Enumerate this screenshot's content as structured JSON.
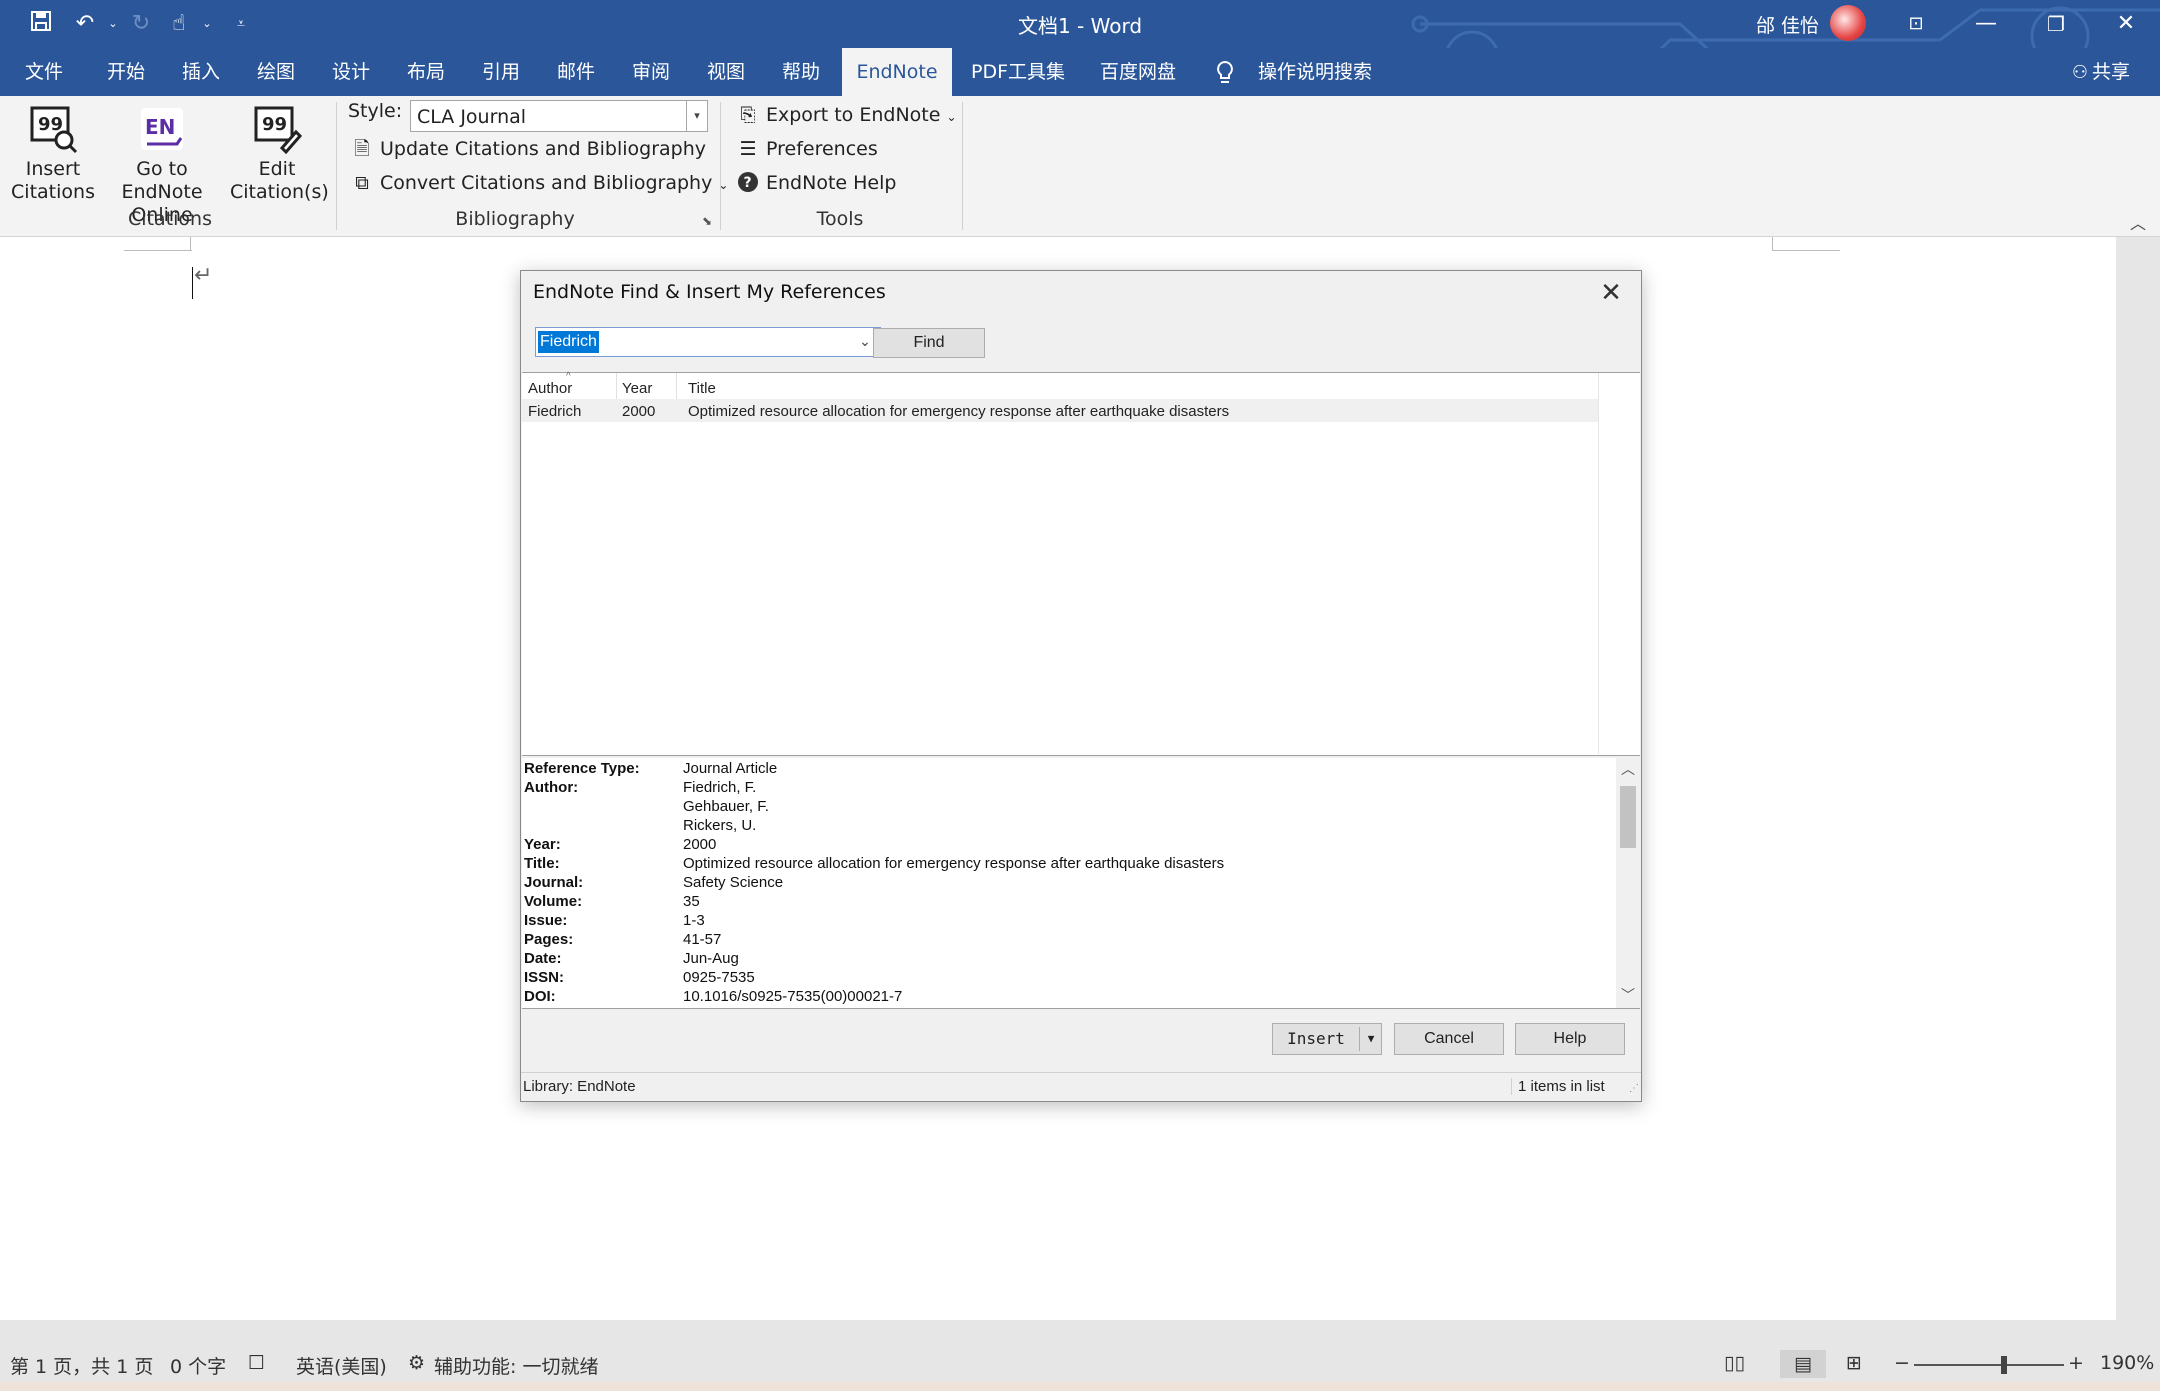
{
  "window": {
    "title": "文档1 - Word",
    "user_name": "邰 佳怡"
  },
  "menu": {
    "tabs": [
      "文件",
      "开始",
      "插入",
      "绘图",
      "设计",
      "布局",
      "引用",
      "邮件",
      "审阅",
      "视图",
      "帮助",
      "EndNote",
      "PDF工具集",
      "百度网盘"
    ],
    "active_tab": "EndNote",
    "tell_me": "操作说明搜索",
    "share": "共享"
  },
  "ribbon": {
    "citations": {
      "insert_line1": "Insert",
      "insert_line2": "Citations",
      "goto_line1": "Go to EndNote",
      "goto_line2": "Online",
      "edit_line1": "Edit",
      "edit_line2": "Citation(s)",
      "group_label": "Citations"
    },
    "bibliography": {
      "style_label": "Style:",
      "style_value": "CLA Journal",
      "update": "Update Citations and Bibliography",
      "convert": "Convert Citations and Bibliography",
      "group_label": "Bibliography"
    },
    "tools": {
      "export": "Export to EndNote",
      "preferences": "Preferences",
      "help": "EndNote Help",
      "group_label": "Tools"
    }
  },
  "dialog": {
    "title": "EndNote Find & Insert My References",
    "search_value": "Fiedrich",
    "find_label": "Find",
    "columns": [
      "Author",
      "Year",
      "Title"
    ],
    "rows": [
      {
        "author": "Fiedrich",
        "year": "2000",
        "title": "Optimized resource allocation for emergency response after earthquake disasters"
      }
    ],
    "details": [
      {
        "label": "Reference Type:",
        "value": "Journal Article"
      },
      {
        "label": "Author:",
        "value": "Fiedrich, F."
      },
      {
        "label": "",
        "value": "Gehbauer, F."
      },
      {
        "label": "",
        "value": "Rickers, U."
      },
      {
        "label": "Year:",
        "value": "2000"
      },
      {
        "label": "Title:",
        "value": "Optimized resource allocation for emergency response after earthquake disasters"
      },
      {
        "label": "Journal:",
        "value": "Safety Science"
      },
      {
        "label": "Volume:",
        "value": "35"
      },
      {
        "label": "Issue:",
        "value": "1-3"
      },
      {
        "label": "Pages:",
        "value": "41-57"
      },
      {
        "label": "Date:",
        "value": "Jun-Aug"
      },
      {
        "label": "ISSN:",
        "value": "0925-7535"
      },
      {
        "label": "DOI:",
        "value": "10.1016/s0925-7535(00)00021-7"
      }
    ],
    "insert_label": "Insert",
    "cancel_label": "Cancel",
    "help_label": "Help",
    "library": "Library: EndNote",
    "count": "1 items in list"
  },
  "status": {
    "page": "第 1 页，共 1 页",
    "words": "0 个字",
    "language": "英语(美国)",
    "accessibility": "辅助功能: 一切就绪",
    "zoom": "190%"
  },
  "colors": {
    "title_bar": "#2b579a",
    "ribbon": "#f3f3f3",
    "selection": "#0078d7"
  }
}
